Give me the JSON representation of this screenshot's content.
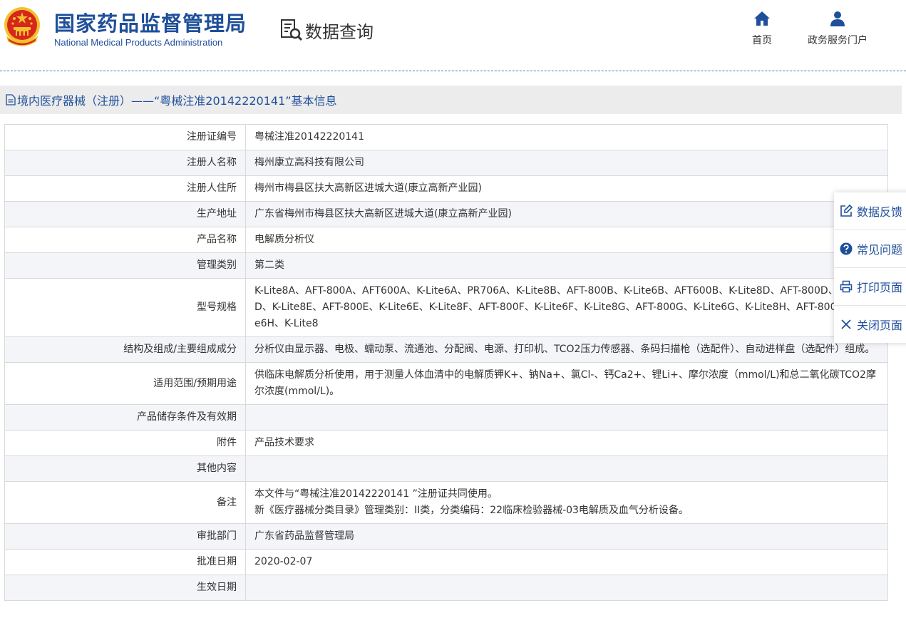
{
  "header": {
    "org_name_cn": "国家药品监督管理局",
    "org_name_en": "National Medical Products Administration",
    "section_title": "数据查询",
    "nav": [
      {
        "label": "首页",
        "icon": "home-icon"
      },
      {
        "label": "政务服务门户",
        "icon": "user-icon"
      }
    ]
  },
  "page": {
    "title": "境内医疗器械（注册）——“粤械注准20142220141”基本信息"
  },
  "rows": [
    {
      "label": "注册证编号",
      "value": [
        "粤械注准20142220141"
      ]
    },
    {
      "label": "注册人名称",
      "value": [
        "梅州康立高科技有限公司"
      ]
    },
    {
      "label": "注册人住所",
      "value": [
        "梅州市梅县区扶大高新区进城大道(康立高新产业园)"
      ]
    },
    {
      "label": "生产地址",
      "value": [
        "广东省梅州市梅县区扶大高新区进城大道(康立高新产业园)"
      ]
    },
    {
      "label": "产品名称",
      "value": [
        "电解质分析仪"
      ]
    },
    {
      "label": "管理类别",
      "value": [
        "第二类"
      ]
    },
    {
      "label": "型号规格",
      "value": [
        "K-Lite8A、AFT-800A、AFT600A、K-Lite6A、PR706A、K-Lite8B、AFT-800B、K-Lite6B、AFT600B、K-Lite8D、AFT-800D、K-Lite6D、K-Lite8E、AFT-800E、K-Lite6E、K-Lite8F、AFT-800F、K-Lite6F、K-Lite8G、AFT-800G、K-Lite6G、K-Lite8H、AFT-800H、K-Lite6H、K-Lite8"
      ]
    },
    {
      "label": "结构及组成/主要组成成分",
      "value": [
        "分析仪由显示器、电极、蠕动泵、流通池、分配阀、电源、打印机、TCO2压力传感器、条码扫描枪（选配件）、自动进样盘（选配件）组成。"
      ]
    },
    {
      "label": "适用范围/预期用途",
      "value": [
        "供临床电解质分析使用，用于测量人体血清中的电解质钾K+、钠Na+、氯Cl-、钙Ca2+、锂Li+、摩尔浓度（mmol/L)和总二氧化碳TCO2摩尔浓度(mmol/L)。"
      ]
    },
    {
      "label": "产品储存条件及有效期",
      "value": [
        ""
      ]
    },
    {
      "label": "附件",
      "value": [
        "产品技术要求"
      ]
    },
    {
      "label": "其他内容",
      "value": [
        ""
      ]
    },
    {
      "label": "备注",
      "value": [
        "本文件与“粤械注准20142220141 ”注册证共同使用。",
        "新《医疗器械分类目录》管理类别：II类，分类编码：22临床检验器械-03电解质及血气分析设备。"
      ]
    },
    {
      "label": "审批部门",
      "value": [
        "广东省药品监督管理局"
      ]
    },
    {
      "label": "批准日期",
      "value": [
        "2020-02-07"
      ]
    },
    {
      "label": "生效日期",
      "value": [
        ""
      ]
    }
  ],
  "side_panel": [
    {
      "label": "数据反馈",
      "icon": "edit-icon"
    },
    {
      "label": "常见问题",
      "icon": "question-icon"
    },
    {
      "label": "打印页面",
      "icon": "printer-icon"
    },
    {
      "label": "关闭页面",
      "icon": "close-icon"
    }
  ],
  "colors": {
    "brand_blue": "#1f4f9a",
    "alt_row": "#f4f5f9",
    "emblem_red": "#d7261c",
    "emblem_gold": "#f2c12e"
  }
}
